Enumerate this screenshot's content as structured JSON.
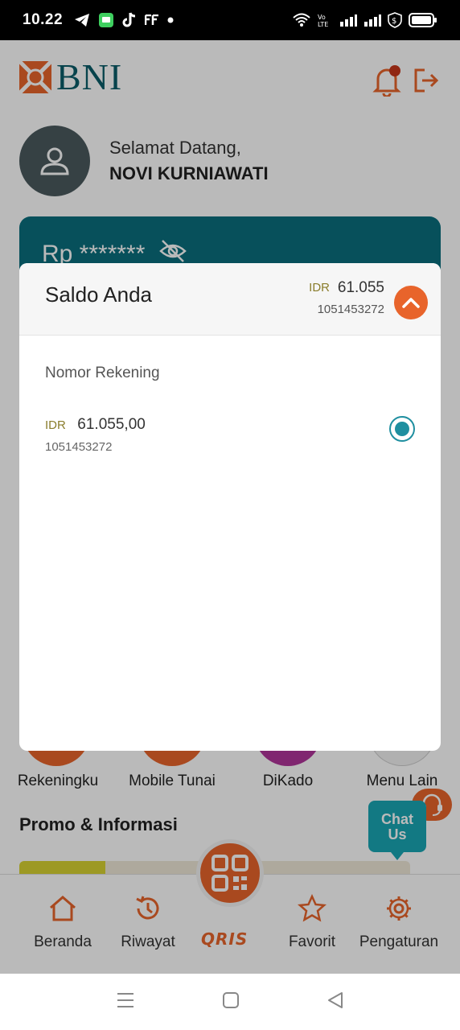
{
  "status_bar": {
    "time": "10.22"
  },
  "header": {
    "logo_text": "BNI"
  },
  "greeting": {
    "hello": "Selamat Datang,",
    "name": "NOVI KURNIAWATI"
  },
  "balance_card": {
    "masked_balance": "Rp *******"
  },
  "modal": {
    "title": "Saldo Anda",
    "currency": "IDR",
    "amount": "61.055",
    "account_number": "1051453272",
    "section_label": "Nomor Rekening",
    "accounts": [
      {
        "currency": "IDR",
        "amount": "61.055,00",
        "number": "1051453272",
        "selected": true
      }
    ]
  },
  "menu": {
    "items": [
      {
        "label": "Rekeningku",
        "color": "#e8642b"
      },
      {
        "label": "Mobile Tunai",
        "color": "#e8642b"
      },
      {
        "label": "DiKado",
        "color": "#b0359a"
      },
      {
        "label": "Menu Lain",
        "color": "#f2f2f2"
      }
    ]
  },
  "promo": {
    "title": "Promo & Informasi"
  },
  "chat": {
    "label_line1": "Chat",
    "label_line2": "Us"
  },
  "bottom_nav": {
    "items": [
      {
        "label": "Beranda",
        "icon": "home-icon"
      },
      {
        "label": "Riwayat",
        "icon": "history-icon"
      },
      {
        "label": "Favorit",
        "icon": "star-icon"
      },
      {
        "label": "Pengaturan",
        "icon": "gear-icon"
      }
    ],
    "qris_label": "QRIS"
  },
  "colors": {
    "brand_orange": "#e8642b",
    "brand_teal": "#0a6e7d",
    "radio_teal": "#1f8fa0"
  }
}
